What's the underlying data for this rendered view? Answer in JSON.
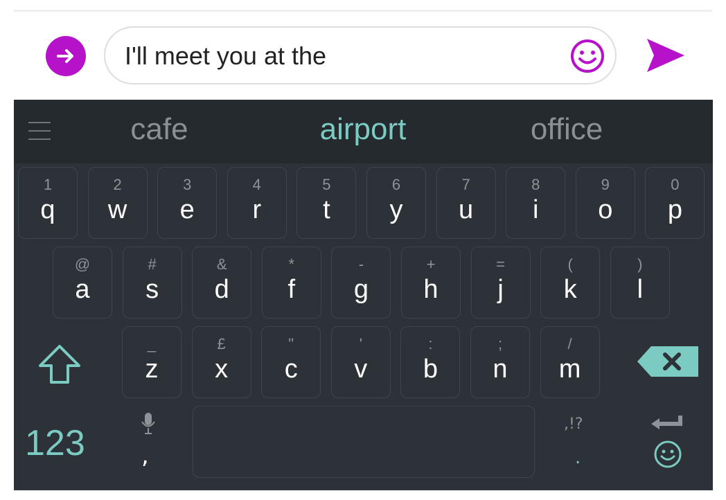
{
  "compose": {
    "text": "I'll meet you at the"
  },
  "suggestions": [
    "cafe",
    "airport",
    "office"
  ],
  "rows": [
    [
      {
        "hint": "1",
        "key": "q"
      },
      {
        "hint": "2",
        "key": "w"
      },
      {
        "hint": "3",
        "key": "e"
      },
      {
        "hint": "4",
        "key": "r"
      },
      {
        "hint": "5",
        "key": "t"
      },
      {
        "hint": "6",
        "key": "y"
      },
      {
        "hint": "7",
        "key": "u"
      },
      {
        "hint": "8",
        "key": "i"
      },
      {
        "hint": "9",
        "key": "o"
      },
      {
        "hint": "0",
        "key": "p"
      }
    ],
    [
      {
        "hint": "@",
        "key": "a"
      },
      {
        "hint": "#",
        "key": "s"
      },
      {
        "hint": "&",
        "key": "d"
      },
      {
        "hint": "*",
        "key": "f"
      },
      {
        "hint": "-",
        "key": "g"
      },
      {
        "hint": "+",
        "key": "h"
      },
      {
        "hint": "=",
        "key": "j"
      },
      {
        "hint": "(",
        "key": "k"
      },
      {
        "hint": ")",
        "key": "l"
      }
    ],
    [
      {
        "hint": "_",
        "key": "z"
      },
      {
        "hint": "£",
        "key": "x"
      },
      {
        "hint": "\"",
        "key": "c"
      },
      {
        "hint": "'",
        "key": "v"
      },
      {
        "hint": ":",
        "key": "b"
      },
      {
        "hint": ";",
        "key": "n"
      },
      {
        "hint": "/",
        "key": "m"
      }
    ]
  ],
  "bottom": {
    "num_label": "123",
    "comma": ",",
    "punct_top": ",!?",
    "punct_bottom": "."
  },
  "colors": {
    "accent_purple": "#b512c9",
    "accent_teal": "#7ccbc3",
    "keyboard_bg": "#2c3237"
  },
  "icons": {
    "expand": "arrow-right-circle-icon",
    "emoji": "smiley-icon",
    "send": "send-icon",
    "shift": "shift-icon",
    "backspace": "backspace-icon",
    "mic": "mic-icon",
    "enter": "enter-icon"
  }
}
